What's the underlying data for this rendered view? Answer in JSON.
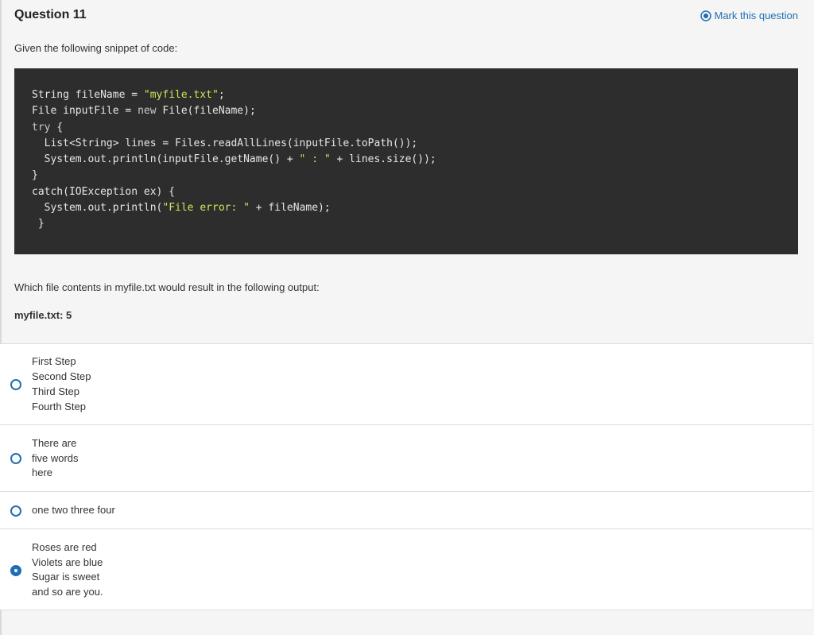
{
  "question": {
    "title": "Question 11",
    "mark_label": "Mark this question",
    "prompt": "Given the following snippet of code:",
    "followup": "Which file contents in myfile.txt would result in the following output:",
    "expected_output": "myfile.txt: 5"
  },
  "code": {
    "lines": [
      [
        "String fileName = ",
        "\"myfile.txt\"",
        ";"
      ],
      [
        "File inputFile = ",
        "new",
        " File(fileName);"
      ],
      [
        "try",
        " {"
      ],
      [
        "  List<String> lines = Files.readAllLines(inputFile.toPath());"
      ],
      [
        "  System.out.println(inputFile.getName() + ",
        "\" : \"",
        " + lines.size());"
      ],
      [
        "}"
      ],
      [
        "catch(IOException ex) {"
      ],
      [
        "  System.out.println(",
        "\"File error: \"",
        " + fileName);"
      ],
      [
        " }"
      ]
    ]
  },
  "options": [
    {
      "lines": [
        "First Step",
        "Second Step",
        "Third Step",
        "Fourth Step"
      ],
      "selected": false
    },
    {
      "lines": [
        "There are",
        "five words",
        "here"
      ],
      "selected": false
    },
    {
      "lines": [
        "one two three four"
      ],
      "selected": false
    },
    {
      "lines": [
        "Roses are red",
        "Violets are blue",
        "Sugar is sweet",
        "and so are you."
      ],
      "selected": true
    }
  ],
  "colors": {
    "accent": "#1f6fb5",
    "code_bg": "#2d2d2d",
    "code_string": "#d4e157"
  }
}
